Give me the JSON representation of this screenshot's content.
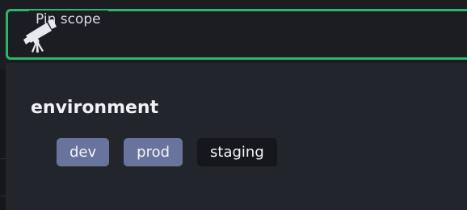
{
  "scope": {
    "legend": "Pin scope",
    "icon": "telescope-icon",
    "border_color": "#2fb46a"
  },
  "section": {
    "title": "environment",
    "tags": [
      {
        "label": "dev",
        "selected": true
      },
      {
        "label": "prod",
        "selected": true
      },
      {
        "label": "staging",
        "selected": false
      }
    ]
  },
  "colors": {
    "background": "#1b1d23",
    "panel": "#23252c",
    "tag_selected": "#68749b",
    "tag_unselected": "#15171c"
  }
}
